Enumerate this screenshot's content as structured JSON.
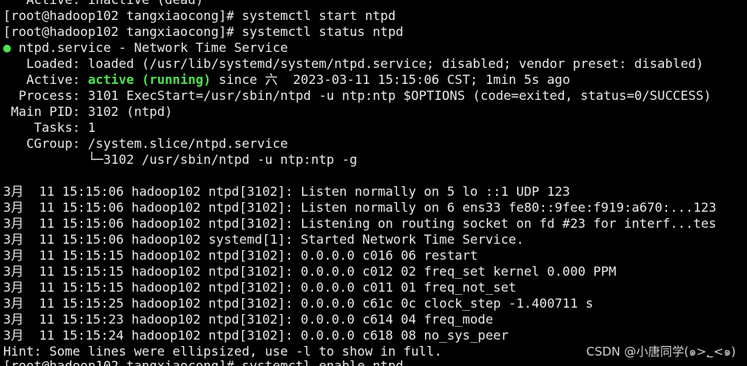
{
  "terminal": {
    "top_cut": "   Active: inactive (dead)",
    "cmd1": "[root@hadoop102 tangxiaocong]# systemctl start ntpd",
    "cmd2": "[root@hadoop102 tangxiaocong]# systemctl status ntpd",
    "service_dot": "●",
    "service_title": " ntpd.service - Network Time Service",
    "loaded": "   Loaded: loaded (/usr/lib/systemd/system/ntpd.service; disabled; vendor preset: disabled)",
    "active_prefix": "   Active: ",
    "active_status": "active (running)",
    "active_suffix": " since 六  2023-03-11 15:15:06 CST; 1min 5s ago",
    "process": "  Process: 3101 ExecStart=/usr/sbin/ntpd -u ntp:ntp $OPTIONS (code=exited, status=0/SUCCESS)",
    "main_pid": " Main PID: 3102 (ntpd)",
    "tasks": "    Tasks: 1",
    "cgroup": "   CGroup: /system.slice/ntpd.service",
    "cgroup_child": "           └─3102 /usr/sbin/ntpd -u ntp:ntp -g",
    "logs": [
      "3月  11 15:15:06 hadoop102 ntpd[3102]: Listen normally on 5 lo ::1 UDP 123",
      "3月  11 15:15:06 hadoop102 ntpd[3102]: Listen normally on 6 ens33 fe80::9fee:f919:a670:...123",
      "3月  11 15:15:06 hadoop102 ntpd[3102]: Listening on routing socket on fd #23 for interf...tes",
      "3月  11 15:15:06 hadoop102 systemd[1]: Started Network Time Service.",
      "3月  11 15:15:15 hadoop102 ntpd[3102]: 0.0.0.0 c016 06 restart",
      "3月  11 15:15:15 hadoop102 ntpd[3102]: 0.0.0.0 c012 02 freq_set kernel 0.000 PPM",
      "3月  11 15:15:15 hadoop102 ntpd[3102]: 0.0.0.0 c011 01 freq_not_set",
      "3月  11 15:15:25 hadoop102 ntpd[3102]: 0.0.0.0 c61c 0c clock_step -1.400711 s",
      "3月  11 15:15:23 hadoop102 ntpd[3102]: 0.0.0.0 c614 04 freq_mode",
      "3月  11 15:15:24 hadoop102 ntpd[3102]: 0.0.0.0 c618 08 no_sys_peer"
    ],
    "hint": "Hint: Some lines were ellipsized, use -l to show in full.",
    "bottom_cut": "[root@hadoop102 tangxiaocong]# systemctl enable ntpd"
  },
  "watermark": "CSDN @小唐同学(๑>؂<๑)",
  "colors": {
    "background": "#000000",
    "text": "#e8e8e8",
    "active": "#4fe04f"
  }
}
